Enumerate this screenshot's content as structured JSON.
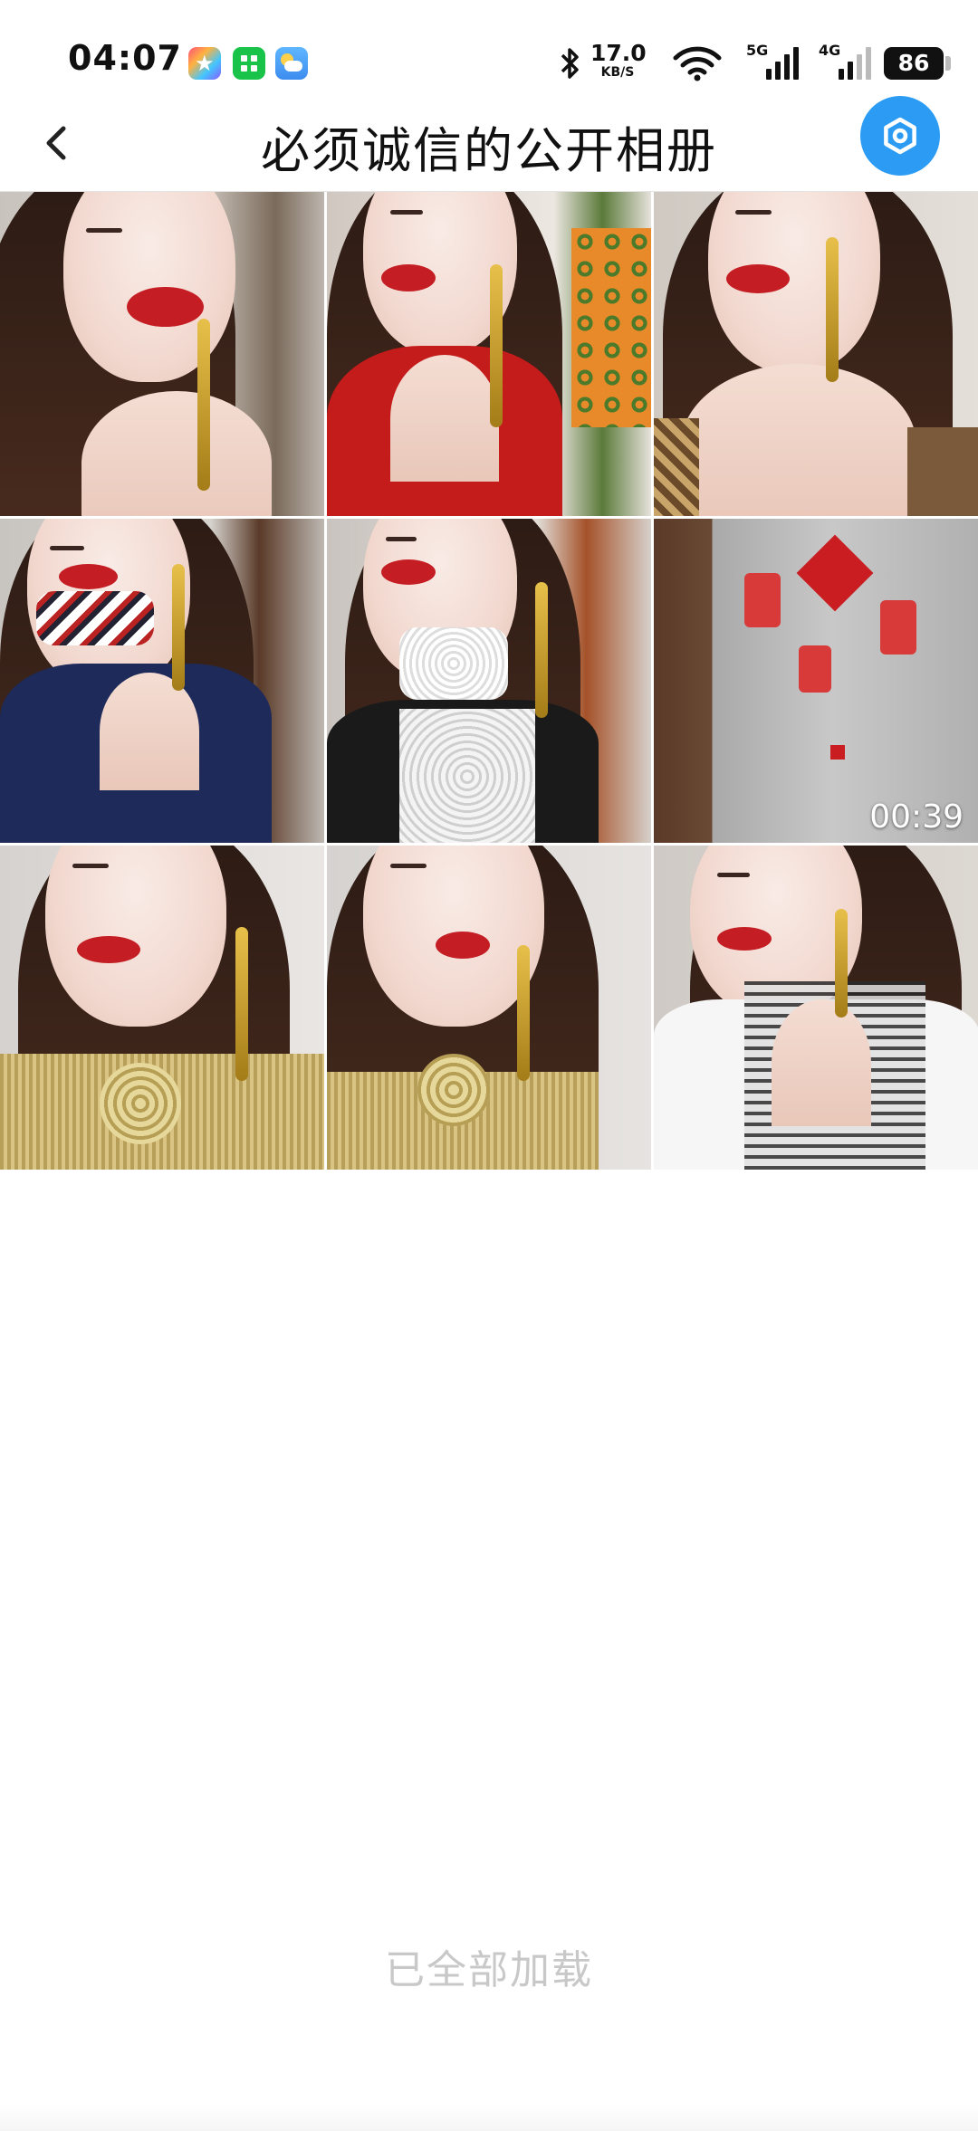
{
  "status_bar": {
    "time": "04:07",
    "net_speed_value": "17.0",
    "net_speed_unit": "KB/S",
    "sim1_label": "5G",
    "sim2_label": "4G",
    "battery": "86",
    "icons": [
      "app-store-icon",
      "wechat-app-icon",
      "weather-icon",
      "bluetooth-icon",
      "wifi-icon",
      "signal-icon",
      "battery-icon"
    ]
  },
  "header": {
    "title": "必须诚信的公开相册",
    "back_icon": "chevron-left-icon",
    "action_icon": "settings-icon",
    "action_color": "#2b9bf4"
  },
  "gallery": {
    "items": [
      {
        "type": "photo"
      },
      {
        "type": "photo"
      },
      {
        "type": "photo"
      },
      {
        "type": "photo"
      },
      {
        "type": "photo"
      },
      {
        "type": "video",
        "duration": "00:39"
      },
      {
        "type": "photo"
      },
      {
        "type": "photo"
      },
      {
        "type": "photo"
      }
    ]
  },
  "footer": {
    "load_status": "已全部加载"
  }
}
